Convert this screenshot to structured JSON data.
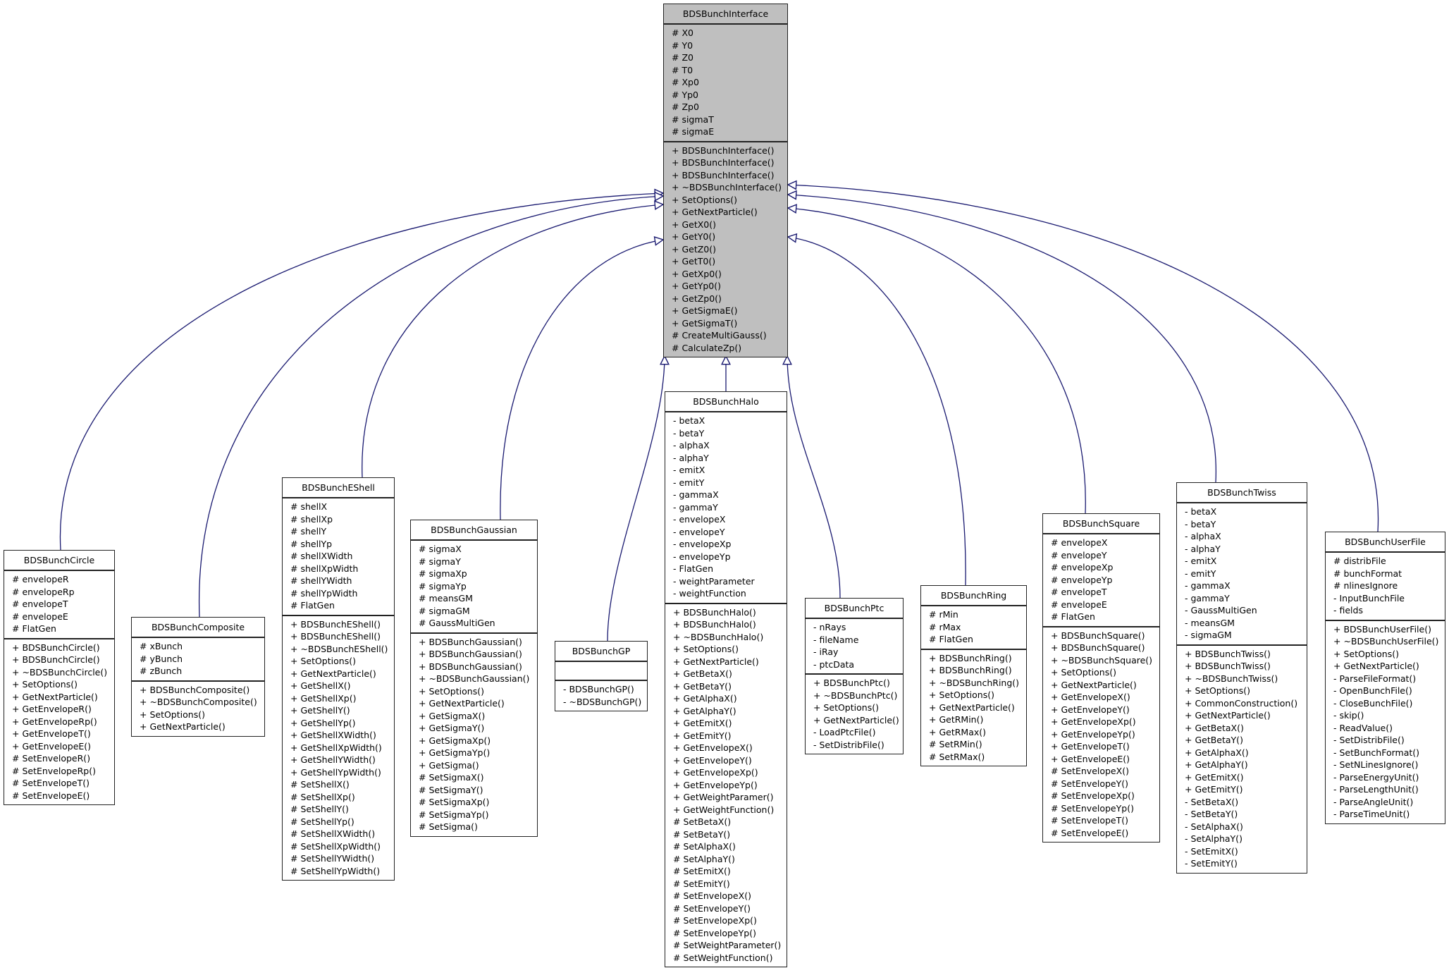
{
  "edge_color": "#191970",
  "base": {
    "name": "BDSBunchInterface",
    "attributes": [
      "# X0",
      "# Y0",
      "# Z0",
      "# T0",
      "# Xp0",
      "# Yp0",
      "# Zp0",
      "# sigmaT",
      "# sigmaE"
    ],
    "methods": [
      "+ BDSBunchInterface()",
      "+ BDSBunchInterface()",
      "+ BDSBunchInterface()",
      "+ ~BDSBunchInterface()",
      "+ SetOptions()",
      "+ GetNextParticle()",
      "+ GetX0()",
      "+ GetY0()",
      "+ GetZ0()",
      "+ GetT0()",
      "+ GetXp0()",
      "+ GetYp0()",
      "+ GetZp0()",
      "+ GetSigmaE()",
      "+ GetSigmaT()",
      "# CreateMultiGauss()",
      "# CalculateZp()"
    ]
  },
  "classes": [
    {
      "name": "BDSBunchCircle",
      "attributes": [
        "# envelopeR",
        "# envelopeRp",
        "# envelopeT",
        "# envelopeE",
        "# FlatGen"
      ],
      "methods": [
        "+ BDSBunchCircle()",
        "+ BDSBunchCircle()",
        "+ ~BDSBunchCircle()",
        "+ SetOptions()",
        "+ GetNextParticle()",
        "+ GetEnvelopeR()",
        "+ GetEnvelopeRp()",
        "+ GetEnvelopeT()",
        "+ GetEnvelopeE()",
        "# SetEnvelopeR()",
        "# SetEnvelopeRp()",
        "# SetEnvelopeT()",
        "# SetEnvelopeE()"
      ]
    },
    {
      "name": "BDSBunchComposite",
      "attributes": [
        "# xBunch",
        "# yBunch",
        "# zBunch"
      ],
      "methods": [
        "+ BDSBunchComposite()",
        "+ ~BDSBunchComposite()",
        "+ SetOptions()",
        "+ GetNextParticle()"
      ]
    },
    {
      "name": "BDSBunchEShell",
      "attributes": [
        "# shellX",
        "# shellXp",
        "# shellY",
        "# shellYp",
        "# shellXWidth",
        "# shellXpWidth",
        "# shellYWidth",
        "# shellYpWidth",
        "# FlatGen"
      ],
      "methods": [
        "+ BDSBunchEShell()",
        "+ BDSBunchEShell()",
        "+ ~BDSBunchEShell()",
        "+ SetOptions()",
        "+ GetNextParticle()",
        "+ GetShellX()",
        "+ GetShellXp()",
        "+ GetShellY()",
        "+ GetShellYp()",
        "+ GetShellXWidth()",
        "+ GetShellXpWidth()",
        "+ GetShellYWidth()",
        "+ GetShellYpWidth()",
        "# SetShellX()",
        "# SetShellXp()",
        "# SetShellY()",
        "# SetShellYp()",
        "# SetShellXWidth()",
        "# SetShellXpWidth()",
        "# SetShellYWidth()",
        "# SetShellYpWidth()"
      ]
    },
    {
      "name": "BDSBunchGaussian",
      "attributes": [
        "# sigmaX",
        "# sigmaY",
        "# sigmaXp",
        "# sigmaYp",
        "# meansGM",
        "# sigmaGM",
        "# GaussMultiGen"
      ],
      "methods": [
        "+ BDSBunchGaussian()",
        "+ BDSBunchGaussian()",
        "+ BDSBunchGaussian()",
        "+ ~BDSBunchGaussian()",
        "+ SetOptions()",
        "+ GetNextParticle()",
        "+ GetSigmaX()",
        "+ GetSigmaY()",
        "+ GetSigmaXp()",
        "+ GetSigmaYp()",
        "+ GetSigma()",
        "# SetSigmaX()",
        "# SetSigmaY()",
        "# SetSigmaXp()",
        "# SetSigmaYp()",
        "# SetSigma()"
      ]
    },
    {
      "name": "BDSBunchGP",
      "attributes": [],
      "methods": [
        "- BDSBunchGP()",
        "- ~BDSBunchGP()"
      ]
    },
    {
      "name": "BDSBunchHalo",
      "attributes": [
        "- betaX",
        "- betaY",
        "- alphaX",
        "- alphaY",
        "- emitX",
        "- emitY",
        "- gammaX",
        "- gammaY",
        "- envelopeX",
        "- envelopeY",
        "- envelopeXp",
        "- envelopeYp",
        "- FlatGen",
        "- weightParameter",
        "- weightFunction"
      ],
      "methods": [
        "+ BDSBunchHalo()",
        "+ BDSBunchHalo()",
        "+ ~BDSBunchHalo()",
        "+ SetOptions()",
        "+ GetNextParticle()",
        "+ GetBetaX()",
        "+ GetBetaY()",
        "+ GetAlphaX()",
        "+ GetAlphaY()",
        "+ GetEmitX()",
        "+ GetEmitY()",
        "+ GetEnvelopeX()",
        "+ GetEnvelopeY()",
        "+ GetEnvelopeXp()",
        "+ GetEnvelopeYp()",
        "+ GetWeightParamer()",
        "+ GetWeightFunction()",
        "# SetBetaX()",
        "# SetBetaY()",
        "# SetAlphaX()",
        "# SetAlphaY()",
        "# SetEmitX()",
        "# SetEmitY()",
        "# SetEnvelopeX()",
        "# SetEnvelopeY()",
        "# SetEnvelopeXp()",
        "# SetEnvelopeYp()",
        "# SetWeightParameter()",
        "# SetWeightFunction()"
      ]
    },
    {
      "name": "BDSBunchPtc",
      "attributes": [
        "- nRays",
        "- fileName",
        "- iRay",
        "- ptcData"
      ],
      "methods": [
        "+ BDSBunchPtc()",
        "+ ~BDSBunchPtc()",
        "+ SetOptions()",
        "+ GetNextParticle()",
        "- LoadPtcFile()",
        "- SetDistribFile()"
      ]
    },
    {
      "name": "BDSBunchRing",
      "attributes": [
        "# rMin",
        "# rMax",
        "# FlatGen"
      ],
      "methods": [
        "+ BDSBunchRing()",
        "+ BDSBunchRing()",
        "+ ~BDSBunchRing()",
        "+ SetOptions()",
        "+ GetNextParticle()",
        "+ GetRMin()",
        "+ GetRMax()",
        "# SetRMin()",
        "# SetRMax()"
      ]
    },
    {
      "name": "BDSBunchSquare",
      "attributes": [
        "# envelopeX",
        "# envelopeY",
        "# envelopeXp",
        "# envelopeYp",
        "# envelopeT",
        "# envelopeE",
        "# FlatGen"
      ],
      "methods": [
        "+ BDSBunchSquare()",
        "+ BDSBunchSquare()",
        "+ ~BDSBunchSquare()",
        "+ SetOptions()",
        "+ GetNextParticle()",
        "+ GetEnvelopeX()",
        "+ GetEnvelopeY()",
        "+ GetEnvelopeXp()",
        "+ GetEnvelopeYp()",
        "+ GetEnvelopeT()",
        "+ GetEnvelopeE()",
        "# SetEnvelopeX()",
        "# SetEnvelopeY()",
        "# SetEnvelopeXp()",
        "# SetEnvelopeYp()",
        "# SetEnvelopeT()",
        "# SetEnvelopeE()"
      ]
    },
    {
      "name": "BDSBunchTwiss",
      "attributes": [
        "- betaX",
        "- betaY",
        "- alphaX",
        "- alphaY",
        "- emitX",
        "- emitY",
        "- gammaX",
        "- gammaY",
        "- GaussMultiGen",
        "- meansGM",
        "- sigmaGM"
      ],
      "methods": [
        "+ BDSBunchTwiss()",
        "+ BDSBunchTwiss()",
        "+ ~BDSBunchTwiss()",
        "+ SetOptions()",
        "+ CommonConstruction()",
        "+ GetNextParticle()",
        "+ GetBetaX()",
        "+ GetBetaY()",
        "+ GetAlphaX()",
        "+ GetAlphaY()",
        "+ GetEmitX()",
        "+ GetEmitY()",
        "- SetBetaX()",
        "- SetBetaY()",
        "- SetAlphaX()",
        "- SetAlphaY()",
        "- SetEmitX()",
        "- SetEmitY()"
      ]
    },
    {
      "name": "BDSBunchUserFile",
      "attributes": [
        "# distribFile",
        "# bunchFormat",
        "# nlinesIgnore",
        "- InputBunchFile",
        "- fields"
      ],
      "methods": [
        "+ BDSBunchUserFile()",
        "+ ~BDSBunchUserFile()",
        "+ SetOptions()",
        "+ GetNextParticle()",
        "- ParseFileFormat()",
        "- OpenBunchFile()",
        "- CloseBunchFile()",
        "- skip()",
        "- ReadValue()",
        "- SetDistribFile()",
        "- SetBunchFormat()",
        "- SetNLinesIgnore()",
        "- ParseEnergyUnit()",
        "- ParseLengthUnit()",
        "- ParseAngleUnit()",
        "- ParseTimeUnit()"
      ]
    }
  ]
}
